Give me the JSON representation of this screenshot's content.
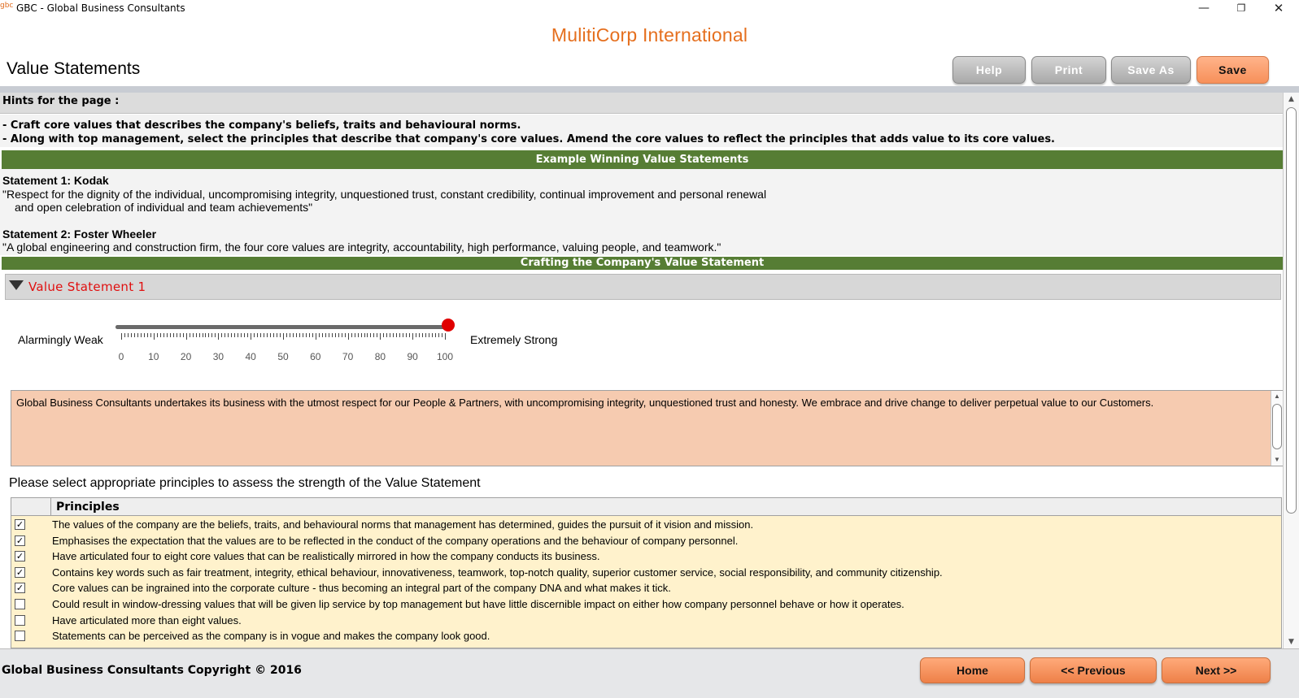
{
  "window": {
    "app_icon": "gbc",
    "title": "GBC - Global Business Consultants",
    "controls": {
      "minimize": "—",
      "restore": "❐",
      "close": "✕"
    }
  },
  "header": {
    "company": "MulitiCorp International",
    "page_title": "Value Statements",
    "buttons": {
      "help": "Help",
      "print": "Print",
      "save_as": "Save As",
      "save": "Save"
    }
  },
  "hints": {
    "heading": "Hints for the page :",
    "lines": [
      "- Craft core values that describes the company's beliefs, traits and behavioural norms.",
      "- Along with top management, select the principles that describe that company's core values. Amend the core values to reflect the principles that adds value to its core values."
    ]
  },
  "examples": {
    "heading": "Example Winning Value Statements",
    "s1_title": "Statement 1: Kodak",
    "s1_line1": "\"Respect for the dignity of the individual, uncompromising integrity, unquestioned trust, constant credibility, continual improvement and personal renewal",
    "s1_line2": "and open celebration of individual and team achievements\"",
    "s2_title": "Statement 2: Foster Wheeler",
    "s2_line1": "\"A global engineering and construction firm, the four core values are integrity, accountability, high performance, valuing people, and teamwork.\""
  },
  "crafting": {
    "heading": "Crafting the Company's Value Statement",
    "section_label": "Value Statement 1"
  },
  "slider": {
    "left_label": "Alarmingly Weak",
    "right_label": "Extremely Strong",
    "value": 100,
    "min": 0,
    "max": 100,
    "tick_labels": [
      "0",
      "10",
      "20",
      "30",
      "40",
      "50",
      "60",
      "70",
      "80",
      "90",
      "100"
    ],
    "knob_color": "#e00000"
  },
  "statement_text": "Global Business Consultants undertakes its business with the utmost respect for our People & Partners, with uncompromising integrity, unquestioned trust and honesty. We embrace and drive change to deliver perpetual value to our Customers.",
  "principles": {
    "prompt": "Please select appropriate principles to assess the strength of the Value Statement",
    "column_header": "Principles",
    "rows": [
      {
        "checked": true,
        "text": "The values of the company are the beliefs, traits, and behavioural norms that management has determined, guides the pursuit of it vision and mission."
      },
      {
        "checked": true,
        "text": "Emphasises the expectation that the values are to be reflected in the conduct of the company operations and the behaviour of company personnel."
      },
      {
        "checked": true,
        "text": "Have articulated four to eight core values that can be realistically mirrored in how the company conducts its business."
      },
      {
        "checked": true,
        "text": "Contains key words such as fair treatment, integrity, ethical behaviour, innovativeness, teamwork, top-notch quality, superior customer service, social responsibility, and community citizenship."
      },
      {
        "checked": true,
        "text": "Core values can be ingrained into the corporate culture - thus becoming an integral part of the company DNA and what makes it tick."
      },
      {
        "checked": false,
        "text": "Could result in window-dressing values that will be given lip service by top management but have little discernible impact on either how company personnel behave or how it operates."
      },
      {
        "checked": false,
        "text": "Have articulated more than eight values."
      },
      {
        "checked": false,
        "text": "Statements can be perceived as the company is in vogue and makes the company look good."
      }
    ]
  },
  "footer": {
    "copyright": "Global Business Consultants Copyright © 2016",
    "buttons": {
      "home": "Home",
      "previous": "<< Previous",
      "next": "Next >>"
    }
  },
  "colors": {
    "brand_orange": "#e56f1e",
    "green_bar": "#567d34",
    "statement_bg": "#f6cbb0",
    "table_bg": "#fff2cc",
    "section_label": "#e01010"
  },
  "icons": {
    "collapse": "triangle-down-icon",
    "checkbox": "check-icon",
    "scroll_up": "scroll-up-icon",
    "scroll_down": "scroll-down-icon"
  }
}
